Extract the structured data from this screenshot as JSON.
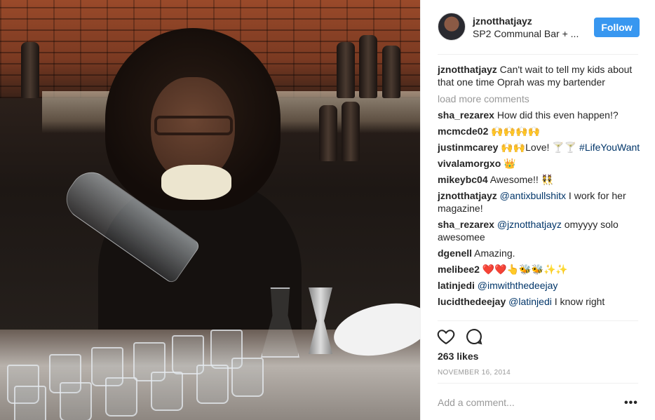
{
  "post": {
    "image_alt": "",
    "author": "jznotthatjayz",
    "location": "SP2 Communal Bar + ...",
    "follow_label": "Follow",
    "caption_user": "jznotthatjayz",
    "caption_text": " Can't wait to tell my kids about that one time Oprah was my bartender",
    "load_more": "load more comments",
    "likes": "263 likes",
    "date": "NOVEMBER 16, 2014",
    "add_comment_placeholder": "Add a comment...",
    "more_label": "•••"
  },
  "comments": [
    {
      "user": "sha_rezarex",
      "text": " How did this even happen!?"
    },
    {
      "user": "mcmcde02",
      "text": " 🙌🙌🙌🙌"
    },
    {
      "user": "justinmcarey",
      "text": " 🙌🙌Love! 🍸🍸 ",
      "mention": "#LifeYouWant"
    },
    {
      "user": "vivalamorgxo",
      "text": " 👑"
    },
    {
      "user": "mikeybc04",
      "text": " Awesome!! 👯"
    },
    {
      "user": "jznotthatjayz",
      "mention_first": "@antixbullshitx",
      "text": " I work for her magazine!"
    },
    {
      "user": "sha_rezarex",
      "mention_first": "@jznotthatjayz",
      "text": " omyyyy solo awesomee"
    },
    {
      "user": "dgenell",
      "text": " Amazing."
    },
    {
      "user": "melibee2",
      "text": " ❤️❤️👆🐝🐝✨✨"
    },
    {
      "user": "latinjedi",
      "mention_first": "@imwiththedeejay",
      "text": ""
    },
    {
      "user": "lucidthedeejay",
      "mention_first": "@latinjedi",
      "text": " I know right"
    }
  ],
  "icons": {
    "like": "heart-outline-icon",
    "comment": "comment-bubble-icon"
  }
}
